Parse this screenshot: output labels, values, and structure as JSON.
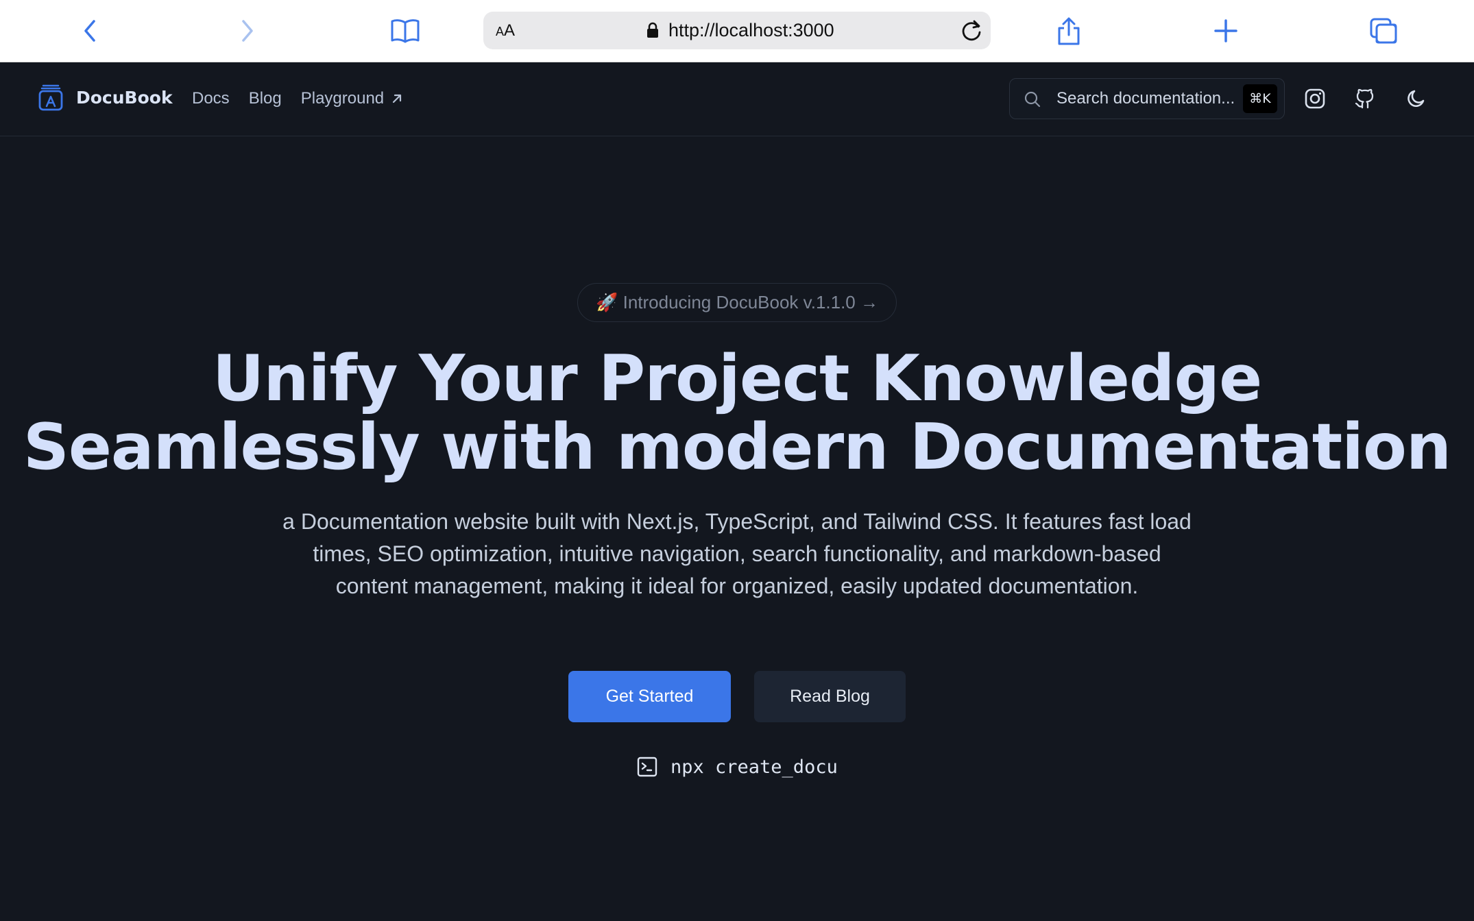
{
  "browser": {
    "url": "http://localhost:3000",
    "aa_label_small": "A",
    "aa_label": "A",
    "accent_color": "#3b76e8"
  },
  "header": {
    "brand": "DocuBook",
    "nav": {
      "docs": "Docs",
      "blog": "Blog",
      "playground": "Playground"
    },
    "search": {
      "placeholder": "Search documentation...",
      "shortcut": "⌘K"
    },
    "icons": [
      "instagram-icon",
      "github-icon",
      "moon-icon"
    ]
  },
  "hero": {
    "badge": "🚀 Introducing DocuBook v.1.1.0 →",
    "headline_line1": "Unify Your Project Knowledge",
    "headline_line2": "Seamlessly with modern Documentation",
    "subtitle": "a Documentation website built with Next.js, TypeScript, and Tailwind CSS. It features fast load times, SEO optimization, intuitive navigation, search functionality, and markdown-based content management, making it ideal for organized, easily updated documentation.",
    "primary_button": "Get Started",
    "secondary_button": "Read Blog",
    "command": "npx create_docu"
  },
  "colors": {
    "background": "#13171f",
    "headline": "#d4e0fb",
    "primary": "#3b76e8"
  }
}
